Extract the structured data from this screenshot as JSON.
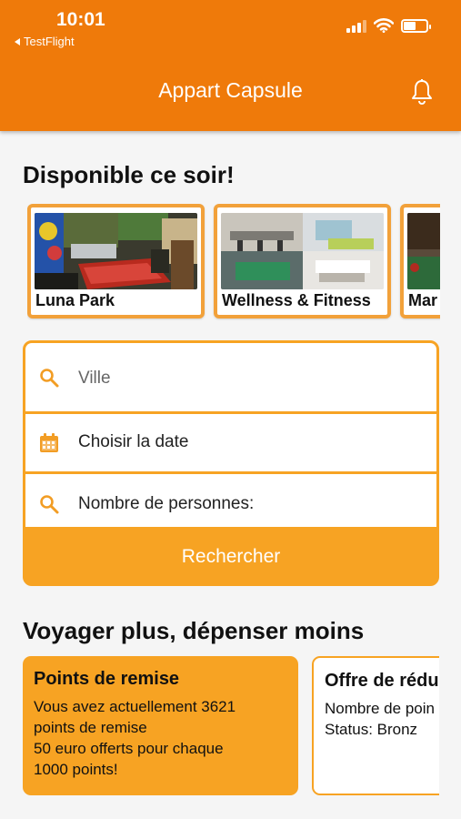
{
  "status_bar": {
    "time": "10:01",
    "back_app": "TestFlight"
  },
  "header": {
    "title": "Appart Capsule"
  },
  "tonight": {
    "title": "Disponible ce soir!",
    "venues": [
      {
        "label": "Luna Park"
      },
      {
        "label": "Wellness & Fitness"
      },
      {
        "label": "Mar"
      }
    ]
  },
  "search": {
    "city_placeholder": "Ville",
    "date_label": "Choisir la date",
    "persons_label": "Nombre de personnes:",
    "button_label": "Rechercher"
  },
  "promo": {
    "title": "Voyager plus, dépenser moins",
    "cards": [
      {
        "title": "Points de remise",
        "lines": [
          "Vous avez actuellement 3621",
          "points de remise",
          "50 euro offerts pour chaque",
          "1000 points!"
        ]
      },
      {
        "title": "Offre de rédu",
        "lines": [
          "Nombre de poin",
          "Status: Bronz"
        ]
      }
    ]
  },
  "colors": {
    "header": "#ef7a0a",
    "accent": "#f7a323",
    "card_border": "#f2a13a"
  },
  "icons": [
    "signal-icon",
    "wifi-icon",
    "battery-icon",
    "bell-icon",
    "search-icon",
    "calendar-icon"
  ]
}
